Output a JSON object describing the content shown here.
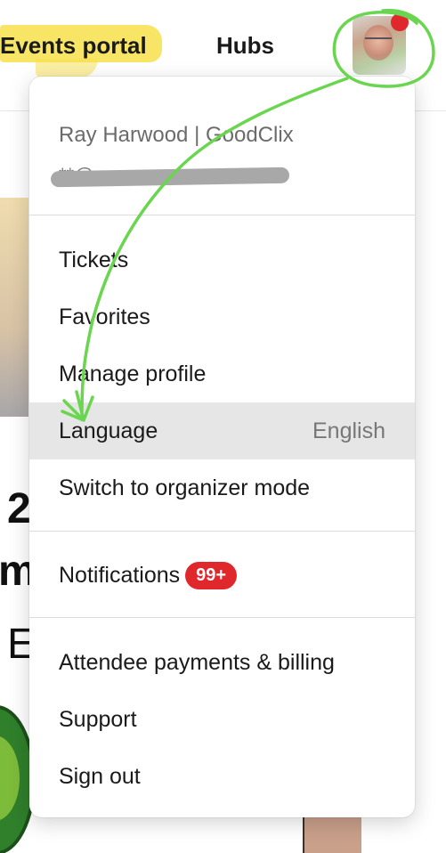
{
  "nav": {
    "events_label": "Events portal",
    "hubs_label": "Hubs"
  },
  "account_menu": {
    "user_name": "Ray Harwood | GoodClix",
    "user_email": "**@",
    "items": [
      {
        "label": "Tickets"
      },
      {
        "label": "Favorites"
      },
      {
        "label": "Manage profile"
      },
      {
        "label": "Language",
        "value": "English"
      },
      {
        "label": "Switch to organizer mode"
      },
      {
        "label": "Notifications",
        "badge": "99+"
      },
      {
        "label": "Attendee payments & billing"
      },
      {
        "label": "Support"
      },
      {
        "label": "Sign out"
      }
    ]
  },
  "background": {
    "line1": "2",
    "line2": "m",
    "line3": "E"
  },
  "colors": {
    "highlight": "#f7e04a",
    "annotation": "#6ad64f",
    "badge": "#e0282c",
    "active_row": "#e6e6e6"
  }
}
